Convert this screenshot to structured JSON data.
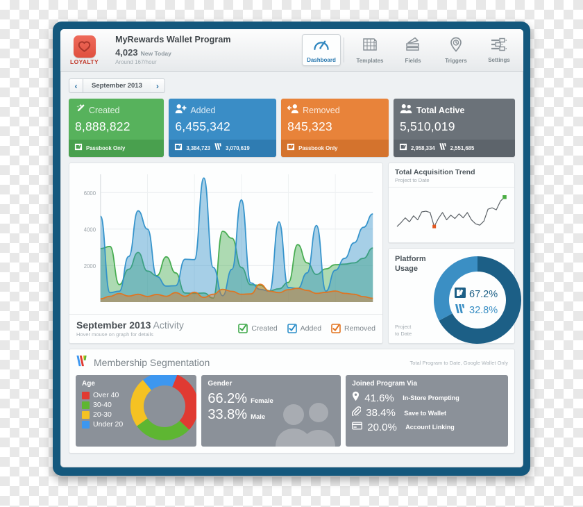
{
  "header": {
    "logo_word": "LOYALTY",
    "program_title": "MyRewards Wallet Program",
    "new_today_value": "4,023",
    "new_today_label": "New Today",
    "rate_text": "Around 167/hour",
    "tabs": [
      {
        "label": "Dashboard",
        "icon": "gauge-icon",
        "active": true
      },
      {
        "label": "Templates",
        "icon": "grid-icon",
        "active": false
      },
      {
        "label": "Fields",
        "icon": "pencil-edit-icon",
        "active": false
      },
      {
        "label": "Triggers",
        "icon": "clock-pin-icon",
        "active": false
      },
      {
        "label": "Settings",
        "icon": "sliders-icon",
        "active": false
      }
    ]
  },
  "daterange": {
    "prev_label": "‹",
    "value": "September 2013",
    "next_label": "›"
  },
  "cards": [
    {
      "title": "Created",
      "value": "8,888,822",
      "icon": "magic-wand-icon",
      "color": "#57b25c",
      "foot_color": "#49a04e",
      "foot": [
        {
          "icon": "passbook-icon",
          "text": "Passbook Only"
        }
      ]
    },
    {
      "title": "Added",
      "value": "6,455,342",
      "icon": "user-add-icon",
      "color": "#3a8dc6",
      "foot_color": "#2f7cb2",
      "foot": [
        {
          "icon": "passbook-icon",
          "text": "3,384,723"
        },
        {
          "icon": "google-wallet-icon",
          "text": "3,070,619"
        }
      ]
    },
    {
      "title": "Removed",
      "value": "845,323",
      "icon": "user-remove-icon",
      "color": "#e8833a",
      "foot_color": "#d4732d",
      "foot": [
        {
          "icon": "passbook-icon",
          "text": "Passbook Only"
        }
      ]
    },
    {
      "title": "Total Active",
      "value": "5,510,019",
      "icon": "users-icon",
      "color": "#6b7279",
      "foot_color": "#5d646b",
      "foot": [
        {
          "icon": "passbook-icon",
          "text": "2,958,334"
        },
        {
          "icon": "google-wallet-icon",
          "text": "2,551,685"
        }
      ]
    }
  ],
  "activity": {
    "title_bold": "September 2013",
    "title_rest": " Activity",
    "subtitle": "Hover mouse on graph for details",
    "legend": [
      {
        "label": "Created",
        "color": "#3fa94a"
      },
      {
        "label": "Added",
        "color": "#2d8fc9"
      },
      {
        "label": "Removed",
        "color": "#e2731f"
      }
    ]
  },
  "trend": {
    "title": "Total Acquisition Trend",
    "subtitle": "Project to Date",
    "start_dot_color": "#e2571f",
    "end_dot_color": "#4aad43"
  },
  "usage": {
    "title_line1": "Platform",
    "title_line2": "Usage",
    "footer_line1": "Project",
    "footer_line2": "to Date",
    "segments": [
      {
        "icon": "passbook-icon",
        "pct": "67.2%",
        "value": 67.2,
        "color": "#1c5f86",
        "text_color": "#1c5f86"
      },
      {
        "icon": "google-wallet-icon",
        "pct": "32.8%",
        "value": 32.8,
        "color": "#3b8fc4",
        "text_color": "#3b8fc4"
      }
    ]
  },
  "segmentation": {
    "title": "Membership Segmentation",
    "note": "Total Program to Date, Google Wallet Only",
    "age": {
      "title": "Age",
      "legend": [
        {
          "label": "Over 40",
          "color": "#e03a32",
          "value": 31
        },
        {
          "label": "30-40",
          "color": "#5eb632",
          "value": 28
        },
        {
          "label": "20-30",
          "color": "#f5c223",
          "value": 24
        },
        {
          "label": "Under 20",
          "color": "#3d97f0",
          "value": 17
        }
      ]
    },
    "gender": {
      "title": "Gender",
      "rows": [
        {
          "pct": "66.2%",
          "label": "Female",
          "value": 66.2
        },
        {
          "pct": "33.8%",
          "label": "Male",
          "value": 33.8
        }
      ]
    },
    "joined": {
      "title": "Joined Program Via",
      "rows": [
        {
          "icon": "map-pin-icon",
          "pct": "41.6%",
          "label": "In-Store Prompting",
          "value": 41.6
        },
        {
          "icon": "paperclip-icon",
          "pct": "38.4%",
          "label": "Save to Wallet",
          "value": 38.4
        },
        {
          "icon": "card-icon",
          "pct": "20.0%",
          "label": "Account Linking",
          "value": 20.0
        }
      ]
    }
  },
  "chart_data": {
    "type": "area",
    "title": "September 2013 Activity",
    "xlabel": "",
    "ylabel": "",
    "ylim": [
      0,
      7000
    ],
    "yticks": [
      2000,
      4000,
      6000
    ],
    "grid": true,
    "legend_position": "bottom-right",
    "x": [
      1,
      2,
      3,
      4,
      5,
      6,
      7,
      8,
      9,
      10,
      11,
      12,
      13,
      14,
      15,
      16,
      17,
      18,
      19,
      20,
      21,
      22,
      23,
      24,
      25,
      26,
      27,
      28,
      29,
      30
    ],
    "series": [
      {
        "name": "Added",
        "color": "#2d8fc9",
        "values": [
          4700,
          520,
          600,
          2500,
          5000,
          4000,
          1400,
          880,
          900,
          2350,
          2330,
          6800,
          1900,
          350,
          1800,
          5600,
          1050,
          700,
          600,
          4400,
          800,
          750,
          1600,
          4200,
          600,
          1750,
          2400,
          3250,
          4100,
          4830
        ]
      },
      {
        "name": "Created",
        "color": "#3fa94a",
        "values": [
          2930,
          3050,
          960,
          1800,
          2720,
          1700,
          1450,
          2480,
          1600,
          500,
          480,
          500,
          220,
          3880,
          3500,
          1900,
          950,
          920,
          620,
          730,
          1080,
          3150,
          2150,
          1520,
          1820,
          2050,
          2080,
          2150,
          2400,
          2960
        ]
      },
      {
        "name": "Removed",
        "color": "#e2731f",
        "values": [
          180,
          320,
          470,
          330,
          430,
          310,
          420,
          320,
          520,
          320,
          540,
          260,
          430,
          700,
          590,
          430,
          450,
          980,
          600,
          520,
          680,
          760,
          640,
          480,
          540,
          610,
          480,
          430,
          300,
          210
        ]
      }
    ]
  }
}
